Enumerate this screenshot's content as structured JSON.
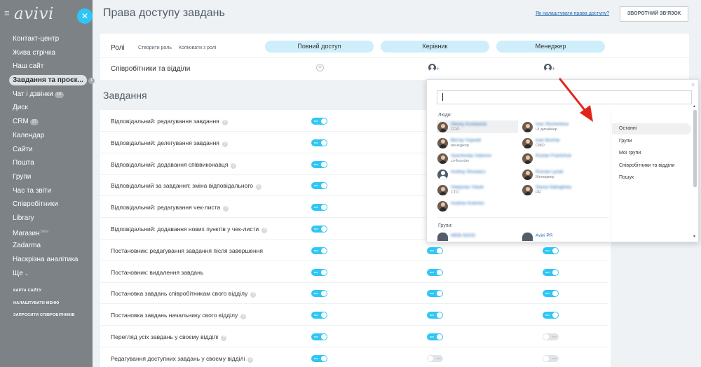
{
  "sidebar": {
    "logo": "avivi",
    "items": [
      {
        "label": "Контакт-центр"
      },
      {
        "label": "Жива стрічка"
      },
      {
        "label": "Наш сайт"
      },
      {
        "label": "Завдання та проєк...",
        "counter": "1",
        "active": true
      },
      {
        "label": "Чат і дзвінки",
        "counter": "10"
      },
      {
        "label": "Диск"
      },
      {
        "label": "CRM",
        "counter": "37"
      },
      {
        "label": "Календар"
      },
      {
        "label": "Сайти"
      },
      {
        "label": "Пошта"
      },
      {
        "label": "Групи"
      },
      {
        "label": "Час та звіти"
      },
      {
        "label": "Співробітники"
      },
      {
        "label": "Library"
      },
      {
        "label": "Магазин",
        "tag": "beta"
      },
      {
        "label": "Zadarma"
      },
      {
        "label": "Наскрізна аналітика"
      },
      {
        "label": "Ще",
        "suffix": "⌄"
      }
    ],
    "bottom_links": [
      "КАРТА САЙТУ",
      "НАЛАШТУВАТИ МЕНЮ",
      "ЗАПРОСИТИ СПІВРОБІТНИКІВ"
    ]
  },
  "header": {
    "title": "Права доступу завдань",
    "help_link": "Як налаштувати права доступу?",
    "feedback_button": "ЗВОРОТНИЙ ЗВ'ЯЗОК"
  },
  "roles": {
    "label": "Ролі",
    "create_role": "Створити роль",
    "copy_from_role": "Копіювати з ролі",
    "columns": [
      "Повний доступ",
      "Керівник",
      "Менеджер"
    ],
    "employees_label": "Співробітники та відділи"
  },
  "tasks": {
    "heading": "Завдання",
    "toggle_text": "вкл",
    "rows": [
      {
        "label": "Відповідальний: редагування завдання",
        "help": true,
        "toggles": [
          true
        ]
      },
      {
        "label": "Відповідальний: делегування завдання",
        "help": true,
        "toggles": [
          true
        ]
      },
      {
        "label": "Відповідальний: додавання співвиконавця",
        "help": true,
        "toggles": [
          true
        ]
      },
      {
        "label": "Відповідальний за завдання: зміна відповідального",
        "help": true,
        "toggles": [
          true
        ]
      },
      {
        "label": "Відповідальний: редагування чек-листа",
        "help": true,
        "toggles": [
          true
        ]
      },
      {
        "label": "Відповідальний: додавання нових пунктів у чек-листи",
        "help": true,
        "toggles": [
          true
        ]
      },
      {
        "label": "Постановник: редагування завдання після завершення",
        "help": false,
        "toggles": [
          true,
          true,
          true
        ]
      },
      {
        "label": "Постановник: видалення завдань",
        "help": false,
        "toggles": [
          true,
          true,
          true
        ]
      },
      {
        "label": "Постановка завдань співробітникам свого відділу",
        "help": true,
        "toggles": [
          true,
          true,
          true
        ]
      },
      {
        "label": "Постановка завдань начальнику свого відділу",
        "help": true,
        "toggles": [
          true,
          true,
          true
        ]
      },
      {
        "label": "Перегляд усіх завдань у своєму відділі",
        "help": true,
        "toggles": [
          true,
          true,
          false
        ]
      },
      {
        "label": "Редагування доступних завдань у своєму відділі",
        "help": true,
        "toggles": [
          true,
          false,
          false
        ]
      }
    ]
  },
  "popup": {
    "people_label": "Люди:",
    "groups_label": "Групи:",
    "search_value": "",
    "people": [
      {
        "name": "Alexey Kovbasiuk",
        "position": "COO",
        "selected": true
      },
      {
        "name": "Ivan Shcherbina",
        "position": "UI дизайнер"
      },
      {
        "name": "Віктор Чорний",
        "position": "менеджер"
      },
      {
        "name": "Ivan Bochar",
        "position": "CMO"
      },
      {
        "name": "Vyacheslav Adamov",
        "position": "co-founder"
      },
      {
        "name": "Ruslan Frantchuk",
        "position": ""
      },
      {
        "name": "Andrey Shostaco",
        "position": "",
        "blank": true
      },
      {
        "name": "Roman Lyzak",
        "position": "Менеджер"
      },
      {
        "name": "Vladyslav Vlasik",
        "position": "CTO"
      },
      {
        "name": "Stasia Nalivgilska",
        "position": "PR"
      },
      {
        "name": "Andrew Kotenko",
        "position": ""
      }
    ],
    "groups": [
      {
        "name": "WEB-SOCK",
        "blurred": true
      },
      {
        "name": "Avivi PR",
        "blurred": false
      }
    ],
    "nav": [
      "Останні",
      "Групи",
      "Мої групи",
      "Співробітники та відділи",
      "Пошук"
    ],
    "active_nav": "Останні"
  },
  "colors": {
    "accent": "#2fc6f6",
    "sidebar_bg": "#7d8287",
    "arrow": "#e3241b"
  }
}
